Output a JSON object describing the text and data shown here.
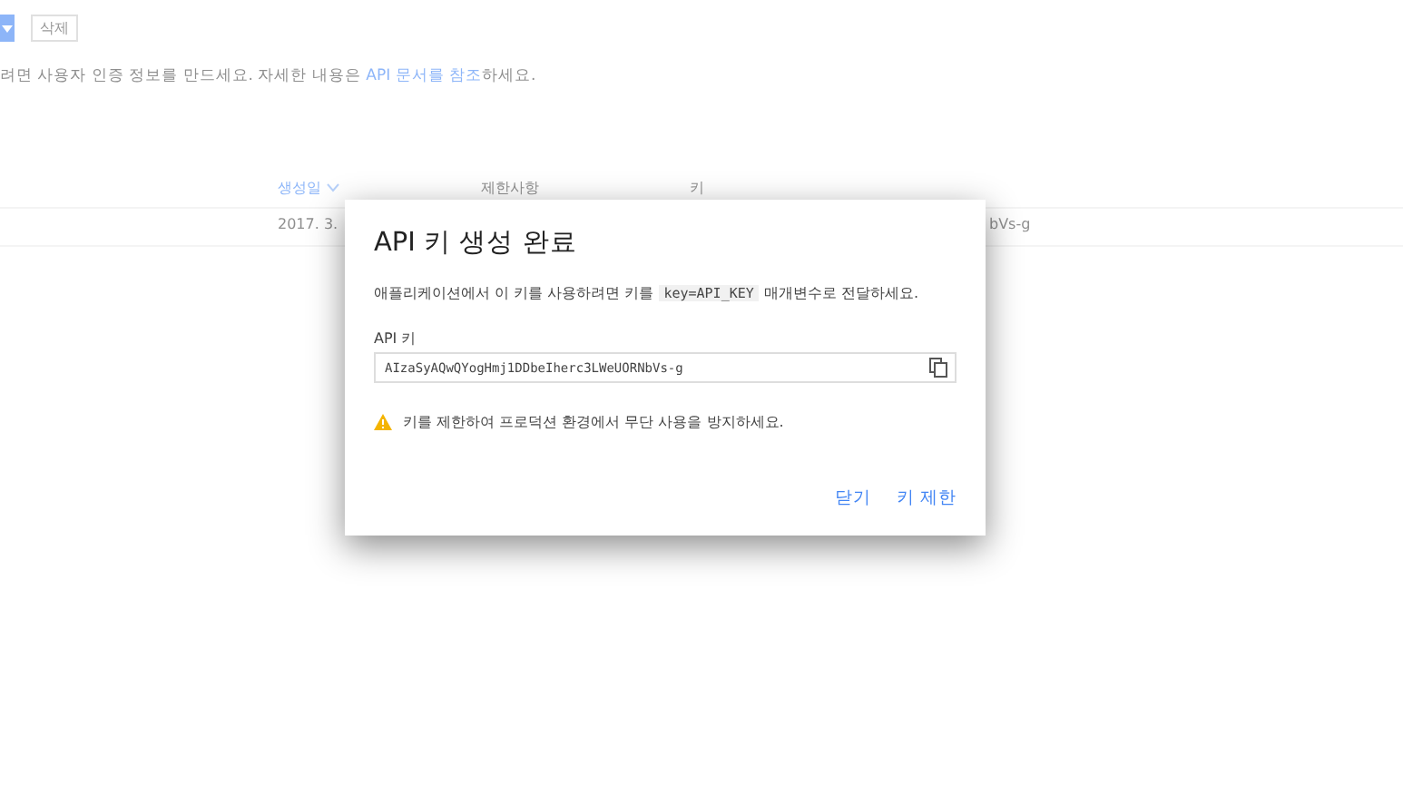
{
  "toolbar": {
    "buttons": [
      {
        "label": "삭제",
        "disabled": true
      }
    ]
  },
  "intro": {
    "before": "려면 사용자 인증 정보를 만드세요. 자세한 내용은 ",
    "link": "API 문서를 참조",
    "after": "하세요."
  },
  "table": {
    "columns": [
      "생성일",
      "제한사항",
      "키"
    ],
    "rows": [
      {
        "date": "2017. 3.",
        "key": "bVs-g"
      }
    ]
  },
  "dialog": {
    "title": "API 키 생성 완료",
    "message_before": "애플리케이션에서 이 키를 사용하려면 키를 ",
    "message_code": "key=API_KEY",
    "message_after": " 매개변수로 전달하세요.",
    "field_label": "API 키",
    "field_value": "AIzaSyAQwQYogHmj1DDbeIherc3LWeUORNbVs-g",
    "warning": "키를 제한하여 프로덕션 환경에서 무단 사용을 방지하세요.",
    "buttons": [
      "닫기",
      "키 제한"
    ]
  }
}
